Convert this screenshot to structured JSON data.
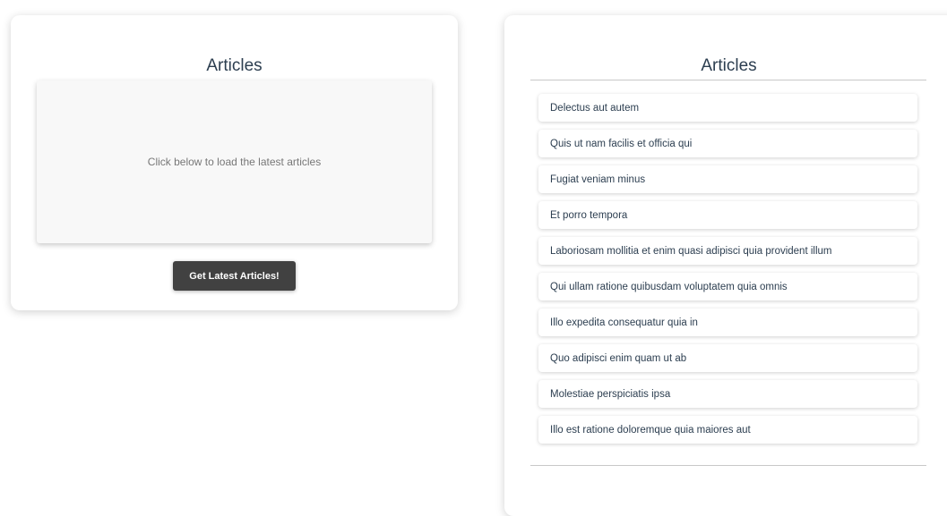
{
  "left_card": {
    "title": "Articles",
    "placeholder_text": "Click below to load the latest articles",
    "button_label": "Get Latest Articles!"
  },
  "right_card": {
    "title": "Articles",
    "articles": [
      "Delectus aut autem",
      "Quis ut nam facilis et officia qui",
      "Fugiat veniam minus",
      "Et porro tempora",
      "Laboriosam mollitia et enim quasi adipisci quia provident illum",
      "Qui ullam ratione quibusdam voluptatem quia omnis",
      "Illo expedita consequatur quia in",
      "Quo adipisci enim quam ut ab",
      "Molestiae perspiciatis ipsa",
      "Illo est ratione doloremque quia maiores aut"
    ]
  }
}
